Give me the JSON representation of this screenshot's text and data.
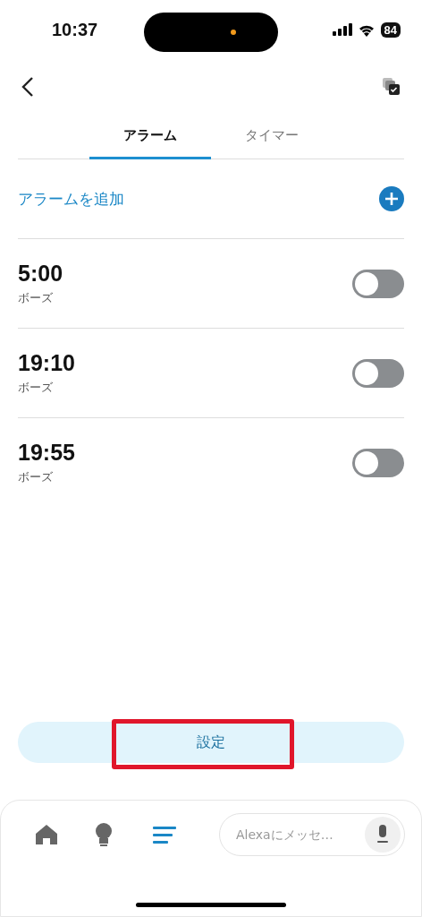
{
  "status_bar": {
    "time": "10:37",
    "battery": "84"
  },
  "tabs": [
    {
      "label": "アラーム",
      "selected": true
    },
    {
      "label": "タイマー",
      "selected": false
    }
  ],
  "add_alarm": {
    "label": "アラームを追加"
  },
  "alarms": [
    {
      "time": "5:00",
      "sound": "ボーズ",
      "on": false
    },
    {
      "time": "19:10",
      "sound": "ボーズ",
      "on": false
    },
    {
      "time": "19:55",
      "sound": "ボーズ",
      "on": false
    }
  ],
  "settings_button": {
    "label": "設定",
    "highlighted": true
  },
  "bottom_nav": [
    {
      "kind": "home",
      "selected": false
    },
    {
      "kind": "bulb",
      "selected": false
    },
    {
      "kind": "list",
      "selected": true
    }
  ],
  "message_field": {
    "placeholder": "Alexaにメッセ…"
  }
}
